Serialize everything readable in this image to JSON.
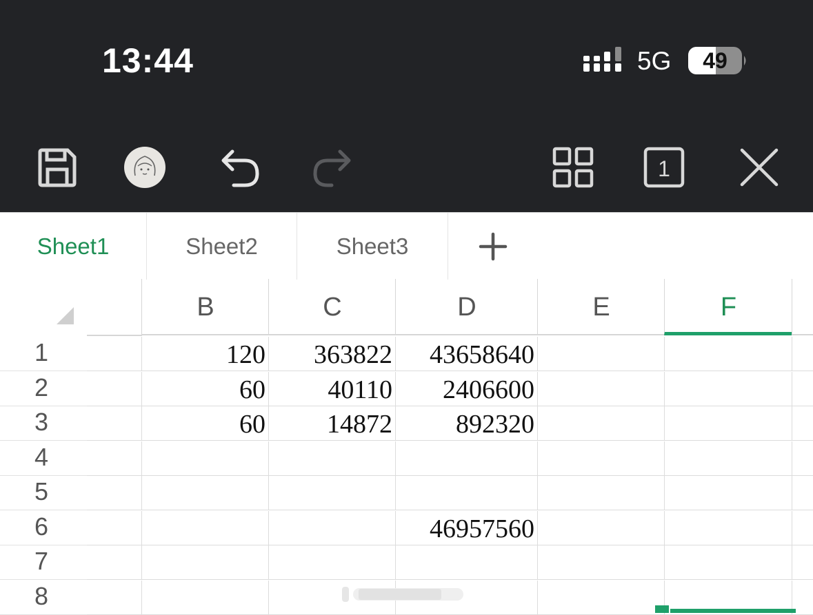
{
  "status_bar": {
    "time": "13:44",
    "network": "5G",
    "battery": "49"
  },
  "toolbar": {
    "icons": [
      "save-icon",
      "avatar",
      "undo-icon",
      "redo-icon",
      "grid-view-icon",
      "sheet-count-icon",
      "close-icon"
    ],
    "sheet_count": "1"
  },
  "sheet_tabs": {
    "tabs": [
      {
        "label": "Sheet1",
        "active": true
      },
      {
        "label": "Sheet2",
        "active": false
      },
      {
        "label": "Sheet3",
        "active": false
      }
    ],
    "add_label": "+"
  },
  "grid": {
    "columns": [
      "B",
      "C",
      "D",
      "E",
      "F"
    ],
    "selected_column": "F",
    "rows": [
      {
        "num": "1",
        "cells": [
          "120",
          "363822",
          "43658640",
          "",
          ""
        ]
      },
      {
        "num": "2",
        "cells": [
          "60",
          "40110",
          "2406600",
          "",
          ""
        ]
      },
      {
        "num": "3",
        "cells": [
          "60",
          "14872",
          "892320",
          "",
          ""
        ]
      },
      {
        "num": "4",
        "cells": [
          "",
          "",
          "",
          "",
          ""
        ]
      },
      {
        "num": "5",
        "cells": [
          "",
          "",
          "",
          "",
          ""
        ]
      },
      {
        "num": "6",
        "cells": [
          "",
          "",
          "46957560",
          "",
          ""
        ]
      },
      {
        "num": "7",
        "cells": [
          "",
          "",
          "",
          "",
          ""
        ]
      },
      {
        "num": "8",
        "cells": [
          "",
          "",
          "",
          "",
          ""
        ]
      }
    ]
  },
  "colors": {
    "accent": "#1fa06a",
    "header_bg": "#222326"
  }
}
